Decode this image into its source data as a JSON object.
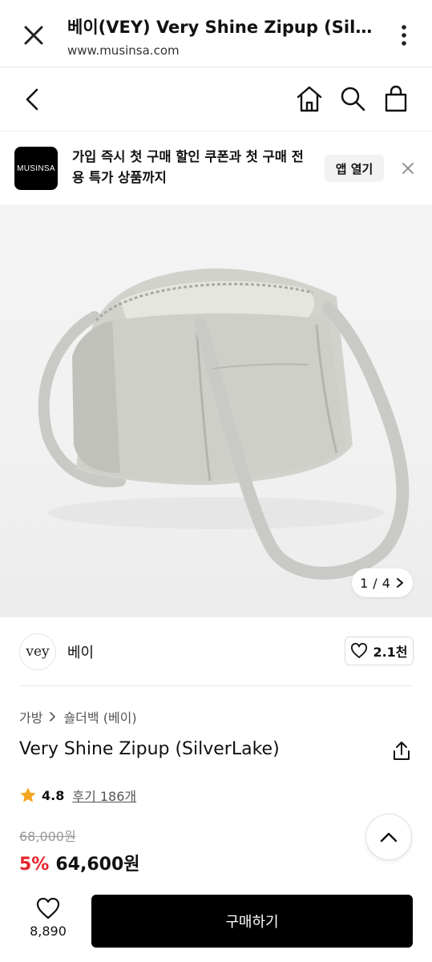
{
  "browser": {
    "title": "베이(VEY) Very Shine Zipup (SilverLake)",
    "url": "www.musinsa.com"
  },
  "promo": {
    "logo_text": "MUSINSA",
    "message": "가입 즉시 첫 구매 할인 쿠폰과 첫 구매 전용 특가 상품까지",
    "open_label": "앱 열기"
  },
  "gallery": {
    "current": "1",
    "separator": "/",
    "total": "4"
  },
  "brand": {
    "logo_text": "vey",
    "name": "베이",
    "likes": "2.1천"
  },
  "product": {
    "breadcrumb": [
      "가방",
      "숄더백 (베이)"
    ],
    "title": "Very Shine Zipup (SilverLake)",
    "rating": "4.8",
    "reviews": "후기 186개",
    "original_price": "68,000원",
    "discount": "5%",
    "price": "64,600원"
  },
  "bottom": {
    "wish_count": "8,890",
    "buy_label": "구매하기"
  },
  "colors": {
    "accent_discount": "#e3242b",
    "star": "#f5a623",
    "buy_button": "#000000"
  },
  "icons": [
    "close-icon",
    "more-vert-icon",
    "back-icon",
    "home-icon",
    "search-icon",
    "shopping-bag-icon",
    "close-x-icon",
    "chevron-right-icon",
    "heart-outline-icon",
    "chevron-right-small-icon",
    "share-icon",
    "star-icon",
    "chevron-up-icon",
    "heart-icon"
  ]
}
